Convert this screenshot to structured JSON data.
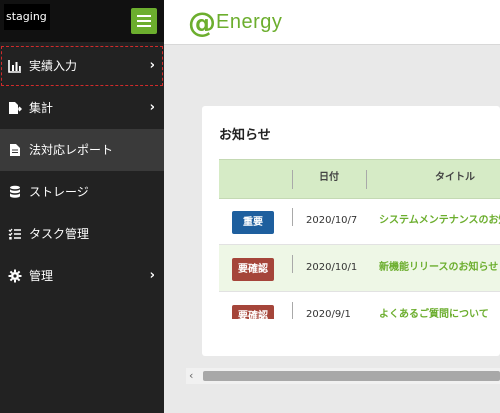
{
  "sidebar": {
    "env_label": "staging",
    "items": [
      {
        "label": "実績入力",
        "icon": "bar-chart-icon",
        "has_chevron": true
      },
      {
        "label": "集計",
        "icon": "export-file-icon",
        "has_chevron": true
      },
      {
        "label": "法対応レポート",
        "icon": "document-icon",
        "has_chevron": false
      },
      {
        "label": "ストレージ",
        "icon": "database-icon",
        "has_chevron": false
      },
      {
        "label": "タスク管理",
        "icon": "task-list-icon",
        "has_chevron": false
      },
      {
        "label": "管理",
        "icon": "gear-icon",
        "has_chevron": true
      }
    ],
    "chevron": "›"
  },
  "header": {
    "logo_mark": "@",
    "logo_text": "Energy"
  },
  "notices": {
    "title": "お知らせ",
    "columns": {
      "date": "日付",
      "title": "タイトル"
    },
    "rows": [
      {
        "badge": "重要",
        "badge_color": "#1e5f9e",
        "date": "2020/10/7",
        "title": "システムメンテナンスのお知らせ"
      },
      {
        "badge": "要確認",
        "badge_color": "#a5453a",
        "date": "2020/10/1",
        "title": "新機能リリースのお知らせ"
      },
      {
        "badge": "要確認",
        "badge_color": "#a5453a",
        "date": "2020/9/1",
        "title": "よくあるご質問について"
      }
    ]
  },
  "scrollbar": {
    "left_arrow": "‹"
  },
  "colors": {
    "accent": "#6cae2e",
    "sidebar_bg": "#222222",
    "table_header_bg": "#d6ebc6"
  }
}
